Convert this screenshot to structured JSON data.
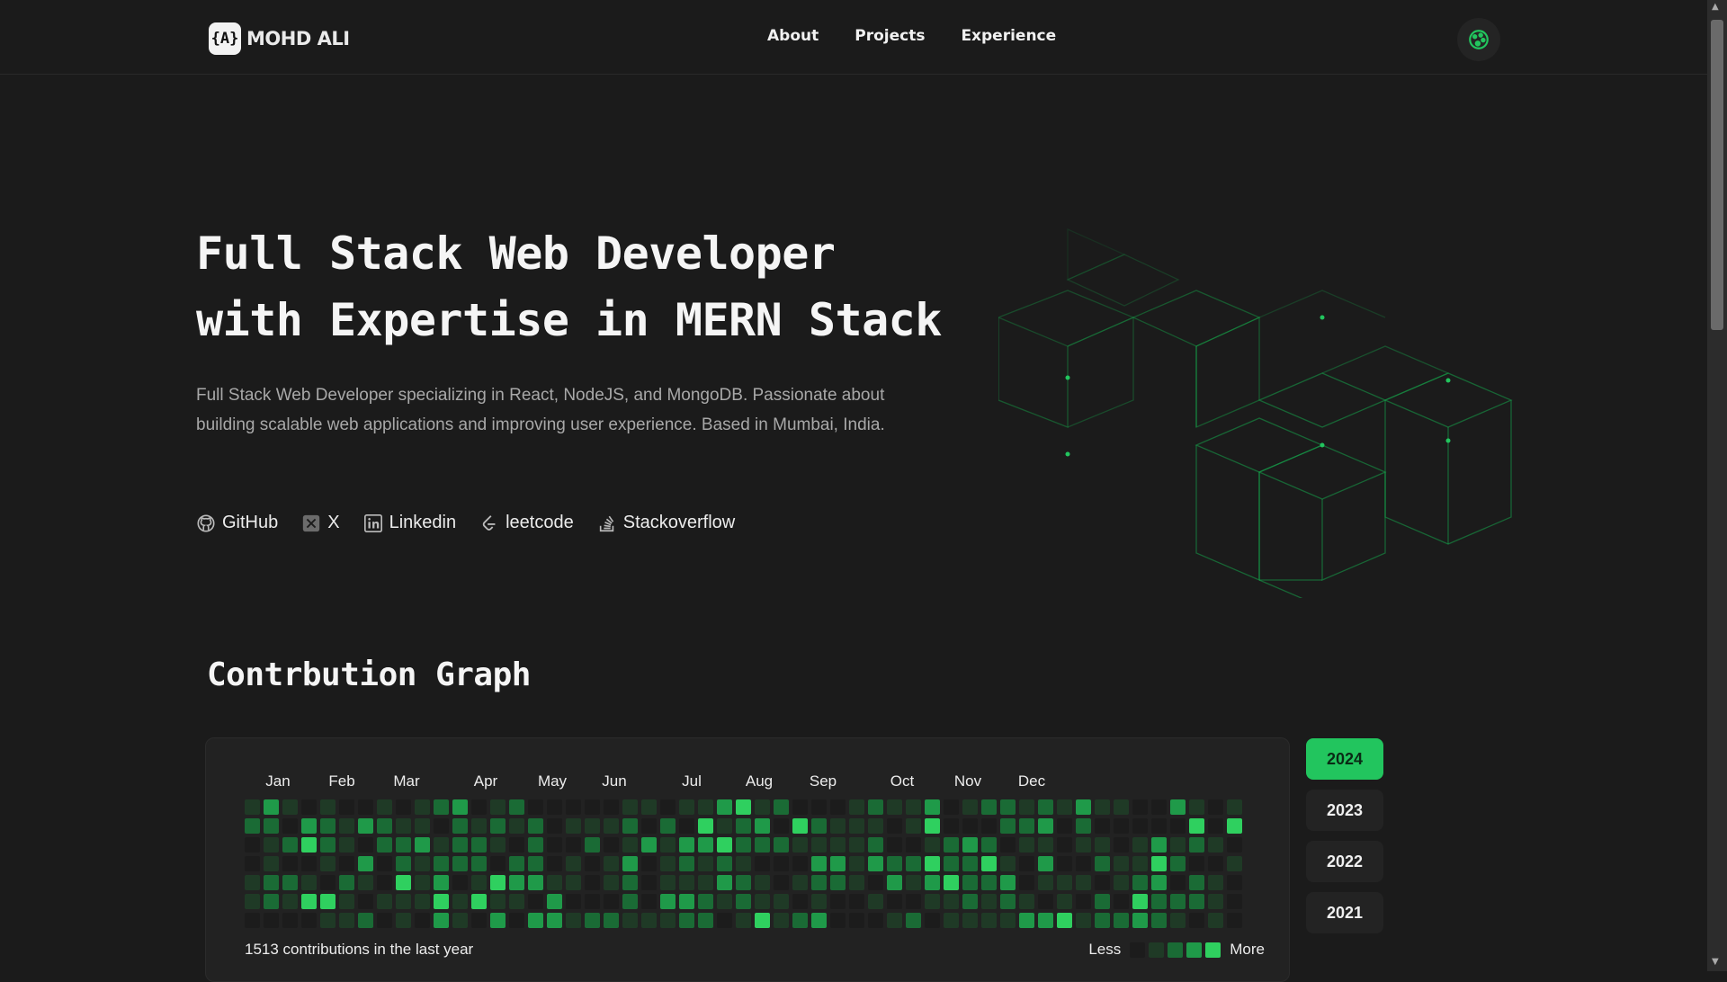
{
  "brand": {
    "logo_mark": "{A}",
    "name": "MOHD ALI"
  },
  "nav": {
    "items": [
      "About",
      "Projects",
      "Experience"
    ]
  },
  "hero": {
    "title": "Full Stack Web Developer with Expertise in MERN Stack",
    "description": "Full Stack Web Developer specializing in React, NodeJS, and MongoDB. Passionate about building scalable web applications and improving user experience. Based in Mumbai, India.",
    "socials": [
      {
        "label": "GitHub",
        "icon": "github-icon"
      },
      {
        "label": "X",
        "icon": "x-icon"
      },
      {
        "label": "Linkedin",
        "icon": "linkedin-icon"
      },
      {
        "label": "leetcode",
        "icon": "leetcode-icon"
      },
      {
        "label": "Stackoverflow",
        "icon": "stackoverflow-icon"
      }
    ]
  },
  "contributions": {
    "title": "Contrbution Graph",
    "months": [
      "Jan",
      "Feb",
      "Mar",
      "Apr",
      "May",
      "Jun",
      "Jul",
      "Aug",
      "Sep",
      "Oct",
      "Nov",
      "Dec"
    ],
    "total_text": "1513 contributions in the last year",
    "legend_less": "Less",
    "legend_more": "More",
    "level_colors": [
      "#1c1c1c",
      "#1f3a26",
      "#1a6b35",
      "#1f9a49",
      "#2fd05f"
    ],
    "years": [
      "2024",
      "2023",
      "2022",
      "2021"
    ],
    "selected_year": "2024"
  },
  "colors": {
    "accent": "#22c55e",
    "background": "#1b1b1b",
    "cube_line": "#16a34a"
  }
}
